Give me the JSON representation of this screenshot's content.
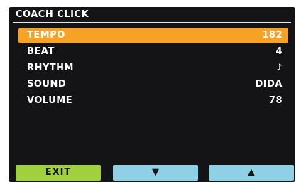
{
  "screen": {
    "title": "COACH CLICK"
  },
  "menu": {
    "items": [
      {
        "label": "TEMPO",
        "value": "182",
        "selected": true
      },
      {
        "label": "BEAT",
        "value": "4",
        "selected": false
      },
      {
        "label": "RHYTHM",
        "value": "♪",
        "selected": false
      },
      {
        "label": "SOUND",
        "value": "DIDA",
        "selected": false
      },
      {
        "label": "VOLUME",
        "value": "78",
        "selected": false
      }
    ]
  },
  "softkeys": {
    "exit_label": "EXIT",
    "down_icon": "▼",
    "up_icon": "▲"
  },
  "colors": {
    "screen_bg": "#141416",
    "selection": "#f7a224",
    "exit_key": "#9fd13f",
    "nav_key": "#8fd0e4"
  }
}
